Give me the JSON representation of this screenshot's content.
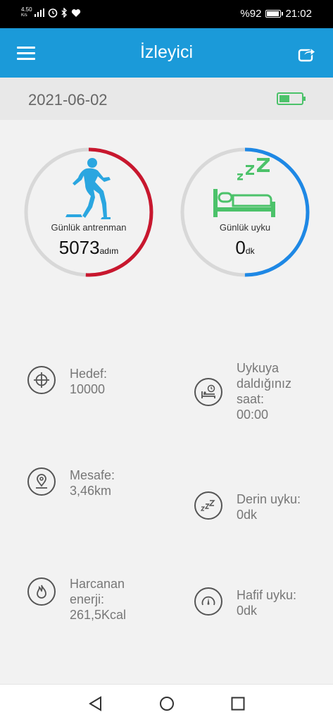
{
  "status_bar": {
    "net_speed": "4.50",
    "net_unit": "K/s",
    "battery": "%92",
    "time": "21:02",
    "battery_level": 0.92,
    "icons": [
      "signal-icon",
      "alarm-icon",
      "bluetooth-icon",
      "heart-icon"
    ]
  },
  "app_bar": {
    "title": "İzleyici",
    "menu_icon": "menu-icon",
    "share_icon": "share-icon"
  },
  "date_bar": {
    "date": "2021-06-02",
    "device_battery_icon": "battery-icon",
    "device_battery_level": 0.45
  },
  "rings": {
    "exercise": {
      "label": "Günlük antrenman",
      "value": "5073",
      "unit": "adım",
      "progress": 0.5073,
      "color": "#c8172e",
      "icon": "runner-icon"
    },
    "sleep": {
      "label": "Günlük uyku",
      "value": "0",
      "unit": "dk",
      "progress": 0.5,
      "color": "#1e88e5",
      "icon": "sleeping-bed-icon"
    }
  },
  "stats": {
    "target": {
      "lines": [
        "Hedef:",
        "10000"
      ],
      "icon": "target-icon"
    },
    "distance": {
      "lines": [
        "Mesafe:",
        "3,46km"
      ],
      "icon": "location-icon"
    },
    "energy": {
      "lines": [
        "Harcanan",
        "enerji:",
        "261,5Kcal"
      ],
      "icon": "flame-icon"
    },
    "sleep_time": {
      "lines": [
        "Uykuya",
        "daldığınız",
        "saat:",
        "00:00"
      ],
      "icon": "bed-clock-icon"
    },
    "deep_sleep": {
      "lines": [
        "Derin uyku:",
        "0dk"
      ],
      "icon": "zzz-icon"
    },
    "light_sleep": {
      "lines": [
        "Hafif uyku:",
        "0dk"
      ],
      "icon": "gauge-icon"
    }
  },
  "colors": {
    "accent": "#1b9ad9",
    "track": "#d8d8d8",
    "sleep_green": "#4cc26a",
    "runner_blue": "#2aa6e0"
  },
  "nav_bar": {
    "icons": [
      "back-icon",
      "home-icon",
      "recents-icon"
    ]
  }
}
